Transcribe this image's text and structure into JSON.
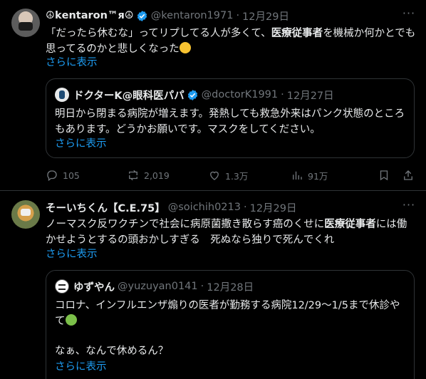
{
  "tweets": [
    {
      "name": "☮kеntаrоn™я☮",
      "handle": "@kentaron1971",
      "date": "12月29日",
      "text_parts": [
        "「だったら休むな」ってリプしてる人が多くて、",
        "医療従事者",
        "を機械か何かとでも思ってるのかと悲しくなった"
      ],
      "show_more": "さらに表示",
      "quote": {
        "name": "ドクターK@眼科医パパ",
        "handle": "@doctorK1991",
        "date": "12月27日",
        "text": "明日から閉まる病院が増えます。発熱しても救急外来はパンク状態のところもあります。どうかお願いです。マスクをしてください。",
        "show_more": "さらに表示"
      },
      "actions": {
        "replies": "105",
        "retweets": "2,019",
        "likes": "1.3万",
        "views": "91万"
      }
    },
    {
      "name": "そーいちくん【C.E.75】",
      "handle": "@soichih0213",
      "date": "12月29日",
      "text_parts": [
        "ノーマスク反ワクチンで社会に病原菌撒き散らす癌のくせに",
        "医療従事者",
        "には働かせようとするの頭おかしすぎる　死ぬなら独りで死んでくれ"
      ],
      "show_more": "さらに表示",
      "quote": {
        "name": "ゆずやん",
        "handle": "@yuzuyan0141",
        "date": "12月28日",
        "text1": "コロナ、インフルエンザ煽りの医者が勤務する病院12/29〜1/5まで休診やて",
        "text2": "なぁ、なんで休めるん？",
        "show_more": "さらに表示"
      }
    }
  ],
  "icons": {
    "verified": "verified-badge-icon",
    "more": "more-icon",
    "reply": "reply-icon",
    "retweet": "retweet-icon",
    "like": "like-icon",
    "views": "views-icon",
    "bookmark": "bookmark-icon",
    "share": "share-icon"
  },
  "colors": {
    "background": "#000000",
    "text": "#e7e9ea",
    "muted": "#71767b",
    "link": "#1d9bf0",
    "border": "#2f3336",
    "verified": "#1d9bf0"
  }
}
